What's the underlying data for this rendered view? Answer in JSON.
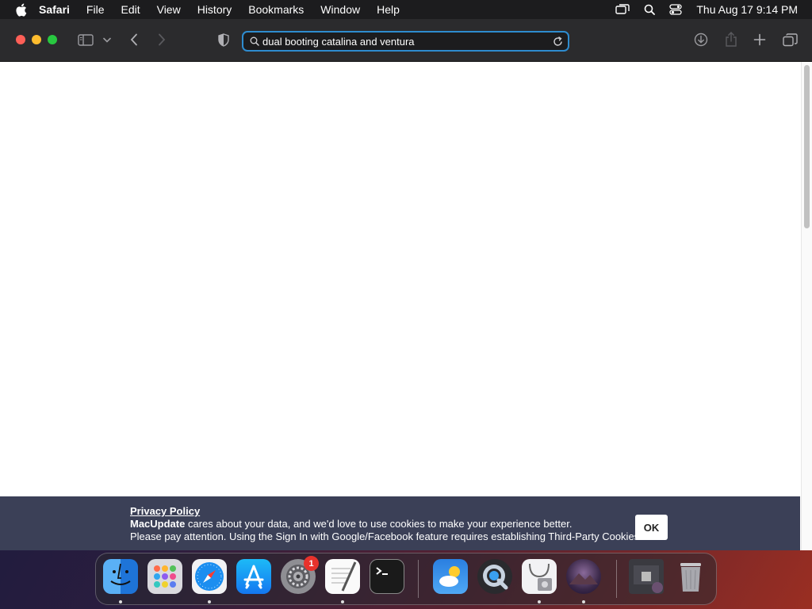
{
  "menubar": {
    "app_name": "Safari",
    "items": [
      "File",
      "Edit",
      "View",
      "History",
      "Bookmarks",
      "Window",
      "Help"
    ],
    "clock": "Thu Aug 17  9:14 PM"
  },
  "toolbar": {
    "search_value": "dual booting catalina and ventura"
  },
  "cookie_banner": {
    "title": "Privacy Policy",
    "brand": "MacUpdate",
    "line1_rest": " cares about your data, and we'd love to use cookies to make your experience better.",
    "line2": "Please pay attention. Using the Sign In with Google/Facebook feature requires establishing Third-Party Cookies.",
    "ok_label": "OK"
  },
  "dock": {
    "apps": [
      "finder-icon",
      "launchpad-icon",
      "safari-icon",
      "app-store-icon",
      "system-settings-icon",
      "textedit-icon",
      "terminal-icon",
      "weather-icon",
      "quicktime-icon",
      "disk-utility-icon",
      "macos-installer-icon",
      "downloads-stack-icon",
      "trash-icon"
    ],
    "settings_badge": "1"
  },
  "colors": {
    "accent": "#2e8ccf",
    "cookie_bg": "#3b4057",
    "toolbar_bg": "#2b2b2d"
  }
}
